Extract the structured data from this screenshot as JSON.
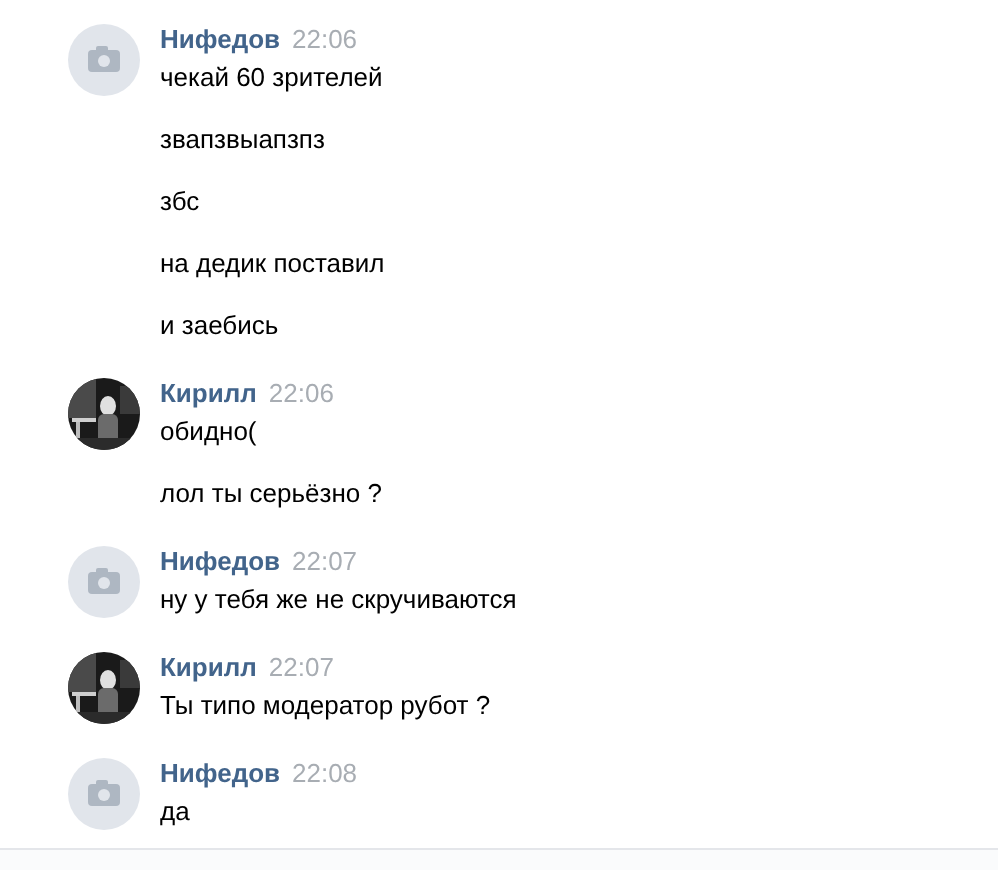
{
  "messages": [
    {
      "author": "Нифедов",
      "time": "22:06",
      "avatar": {
        "kind": "camera"
      },
      "texts": [
        "чекай 60 зрителей",
        "звапзвыапзпз",
        "збс",
        "на дедик поставил",
        "и заебись"
      ]
    },
    {
      "author": "Кирилл",
      "time": "22:06",
      "avatar": {
        "kind": "picture"
      },
      "texts": [
        "обидно(",
        "лол ты серьёзно ?"
      ]
    },
    {
      "author": "Нифедов",
      "time": "22:07",
      "avatar": {
        "kind": "camera"
      },
      "texts": [
        "ну у тебя же не скручиваются"
      ]
    },
    {
      "author": "Кирилл",
      "time": "22:07",
      "avatar": {
        "kind": "picture"
      },
      "texts": [
        "Ты типо модератор рубот ?"
      ]
    },
    {
      "author": "Нифедов",
      "time": "22:08",
      "avatar": {
        "kind": "camera"
      },
      "texts": [
        "да"
      ]
    }
  ]
}
